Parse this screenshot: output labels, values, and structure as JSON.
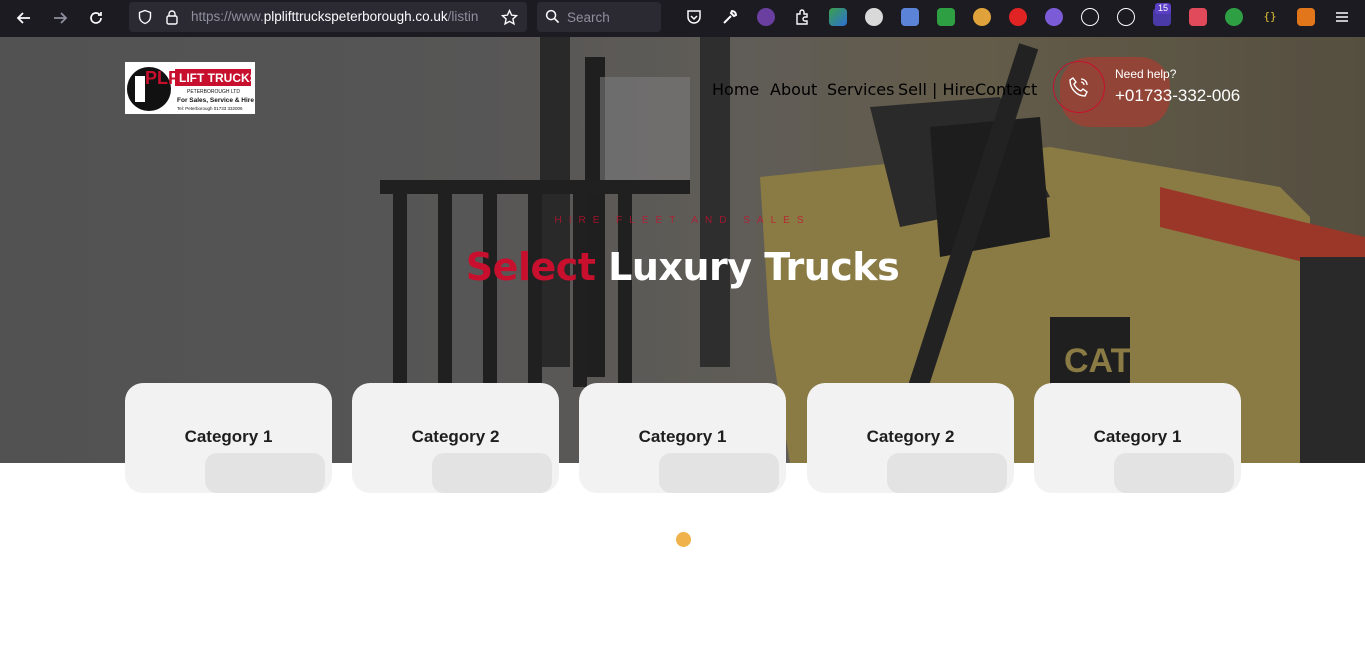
{
  "browser": {
    "url_host": "https://www.",
    "url_domain": "plplifttruckspeterborough.co.uk",
    "url_path": "/listin",
    "search_placeholder": "Search",
    "extension_badge": "15",
    "icons": [
      "back-icon",
      "forward-icon",
      "reload-icon",
      "shield-icon",
      "lock-icon",
      "star-icon",
      "search-icon",
      "pocket-icon",
      "wrench-icon",
      "extensions-icon",
      "menu-icon"
    ]
  },
  "site": {
    "logo_text": "PLP LIFT TRUCKS",
    "nav": [
      "Home",
      "About",
      "Services",
      "Sell | Hire",
      "Contact"
    ],
    "help_label": "Need help?",
    "phone": "+01733-332-006"
  },
  "hero": {
    "kicker": "HIRE FLEET AND SALES",
    "headline_accent": "Select",
    "headline_rest": " Luxury Trucks"
  },
  "categories": [
    "Category 1",
    "Category 2",
    "Category 1",
    "Category 2",
    "Category 1"
  ],
  "colors": {
    "accent_red": "#c8102e",
    "loader_dot": "#f0b24a",
    "card_bg": "#f2f2f2"
  }
}
